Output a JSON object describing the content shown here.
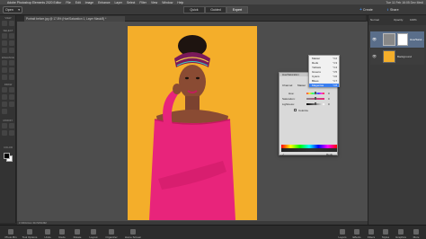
{
  "titlebar": {
    "app": "Adobe Photoshop Elements 2020 Editor",
    "menus": [
      "File",
      "Edit",
      "Image",
      "Enhance",
      "Layer",
      "Select",
      "Filter",
      "View",
      "Window",
      "Help"
    ],
    "clock": "Tue 11 Feb 16:05   Dev Medi"
  },
  "appbar": {
    "open_label": "Open",
    "tabs": [
      "Quick",
      "Guided",
      "Expert"
    ],
    "active_tab": "Expert",
    "create_label": "Create",
    "share_label": "Share"
  },
  "document": {
    "tab_title": "Portrait before.jpg @ 17.8% (Hue/Saturation 1, Layer Mask/8) *",
    "status": "17.84%   Doc: 69.7M/30.8M"
  },
  "toolbox": {
    "sections": [
      "VIEW",
      "SELECT",
      "ENHANCE",
      "DRAW",
      "MODIFY",
      "COLOR"
    ]
  },
  "right_panel": {
    "blend_mode": "Normal",
    "opacity_label": "Opacity:",
    "opacity_value": "100%",
    "layers": [
      {
        "name": "Hue/Satur..."
      },
      {
        "name": "Background"
      }
    ]
  },
  "hue_saturation": {
    "title": "Hue/Saturation",
    "channel_label": "Channel:",
    "channel_value": "Master",
    "hue_label": "Hue:",
    "hue_value": "0",
    "saturation_label": "Saturation:",
    "saturation_value": "0",
    "lightness_label": "Lightness:",
    "lightness_value": "0",
    "colorize_label": "Colorize",
    "footer_left": "✓",
    "footer_right": "Reds"
  },
  "channel_dropdown": {
    "items": [
      {
        "label": "Master",
        "shortcut": "⌥2"
      },
      {
        "label": "Reds",
        "shortcut": "⌥3"
      },
      {
        "label": "Yellows",
        "shortcut": "⌥4"
      },
      {
        "label": "Greens",
        "shortcut": "⌥5"
      },
      {
        "label": "Cyans",
        "shortcut": "⌥6"
      },
      {
        "label": "Blues",
        "shortcut": "⌥7"
      },
      {
        "label": "Magentas",
        "shortcut": "⌥8"
      }
    ],
    "selected": "Magentas"
  },
  "bottombar": {
    "left_items": [
      "Photo Bin",
      "Tool Options",
      "Undo",
      "Redo",
      "Rotate",
      "Layout",
      "Organizer",
      "Home Screen"
    ],
    "right_items": [
      "Layers",
      "Effects",
      "Filters",
      "Styles",
      "Graphics",
      "More"
    ]
  },
  "colors": {
    "canvas_bg": "#4d4d4d",
    "photo_bg": "#f4ae2a",
    "dress": "#e8247b",
    "accent_blue": "#4d9bff"
  }
}
